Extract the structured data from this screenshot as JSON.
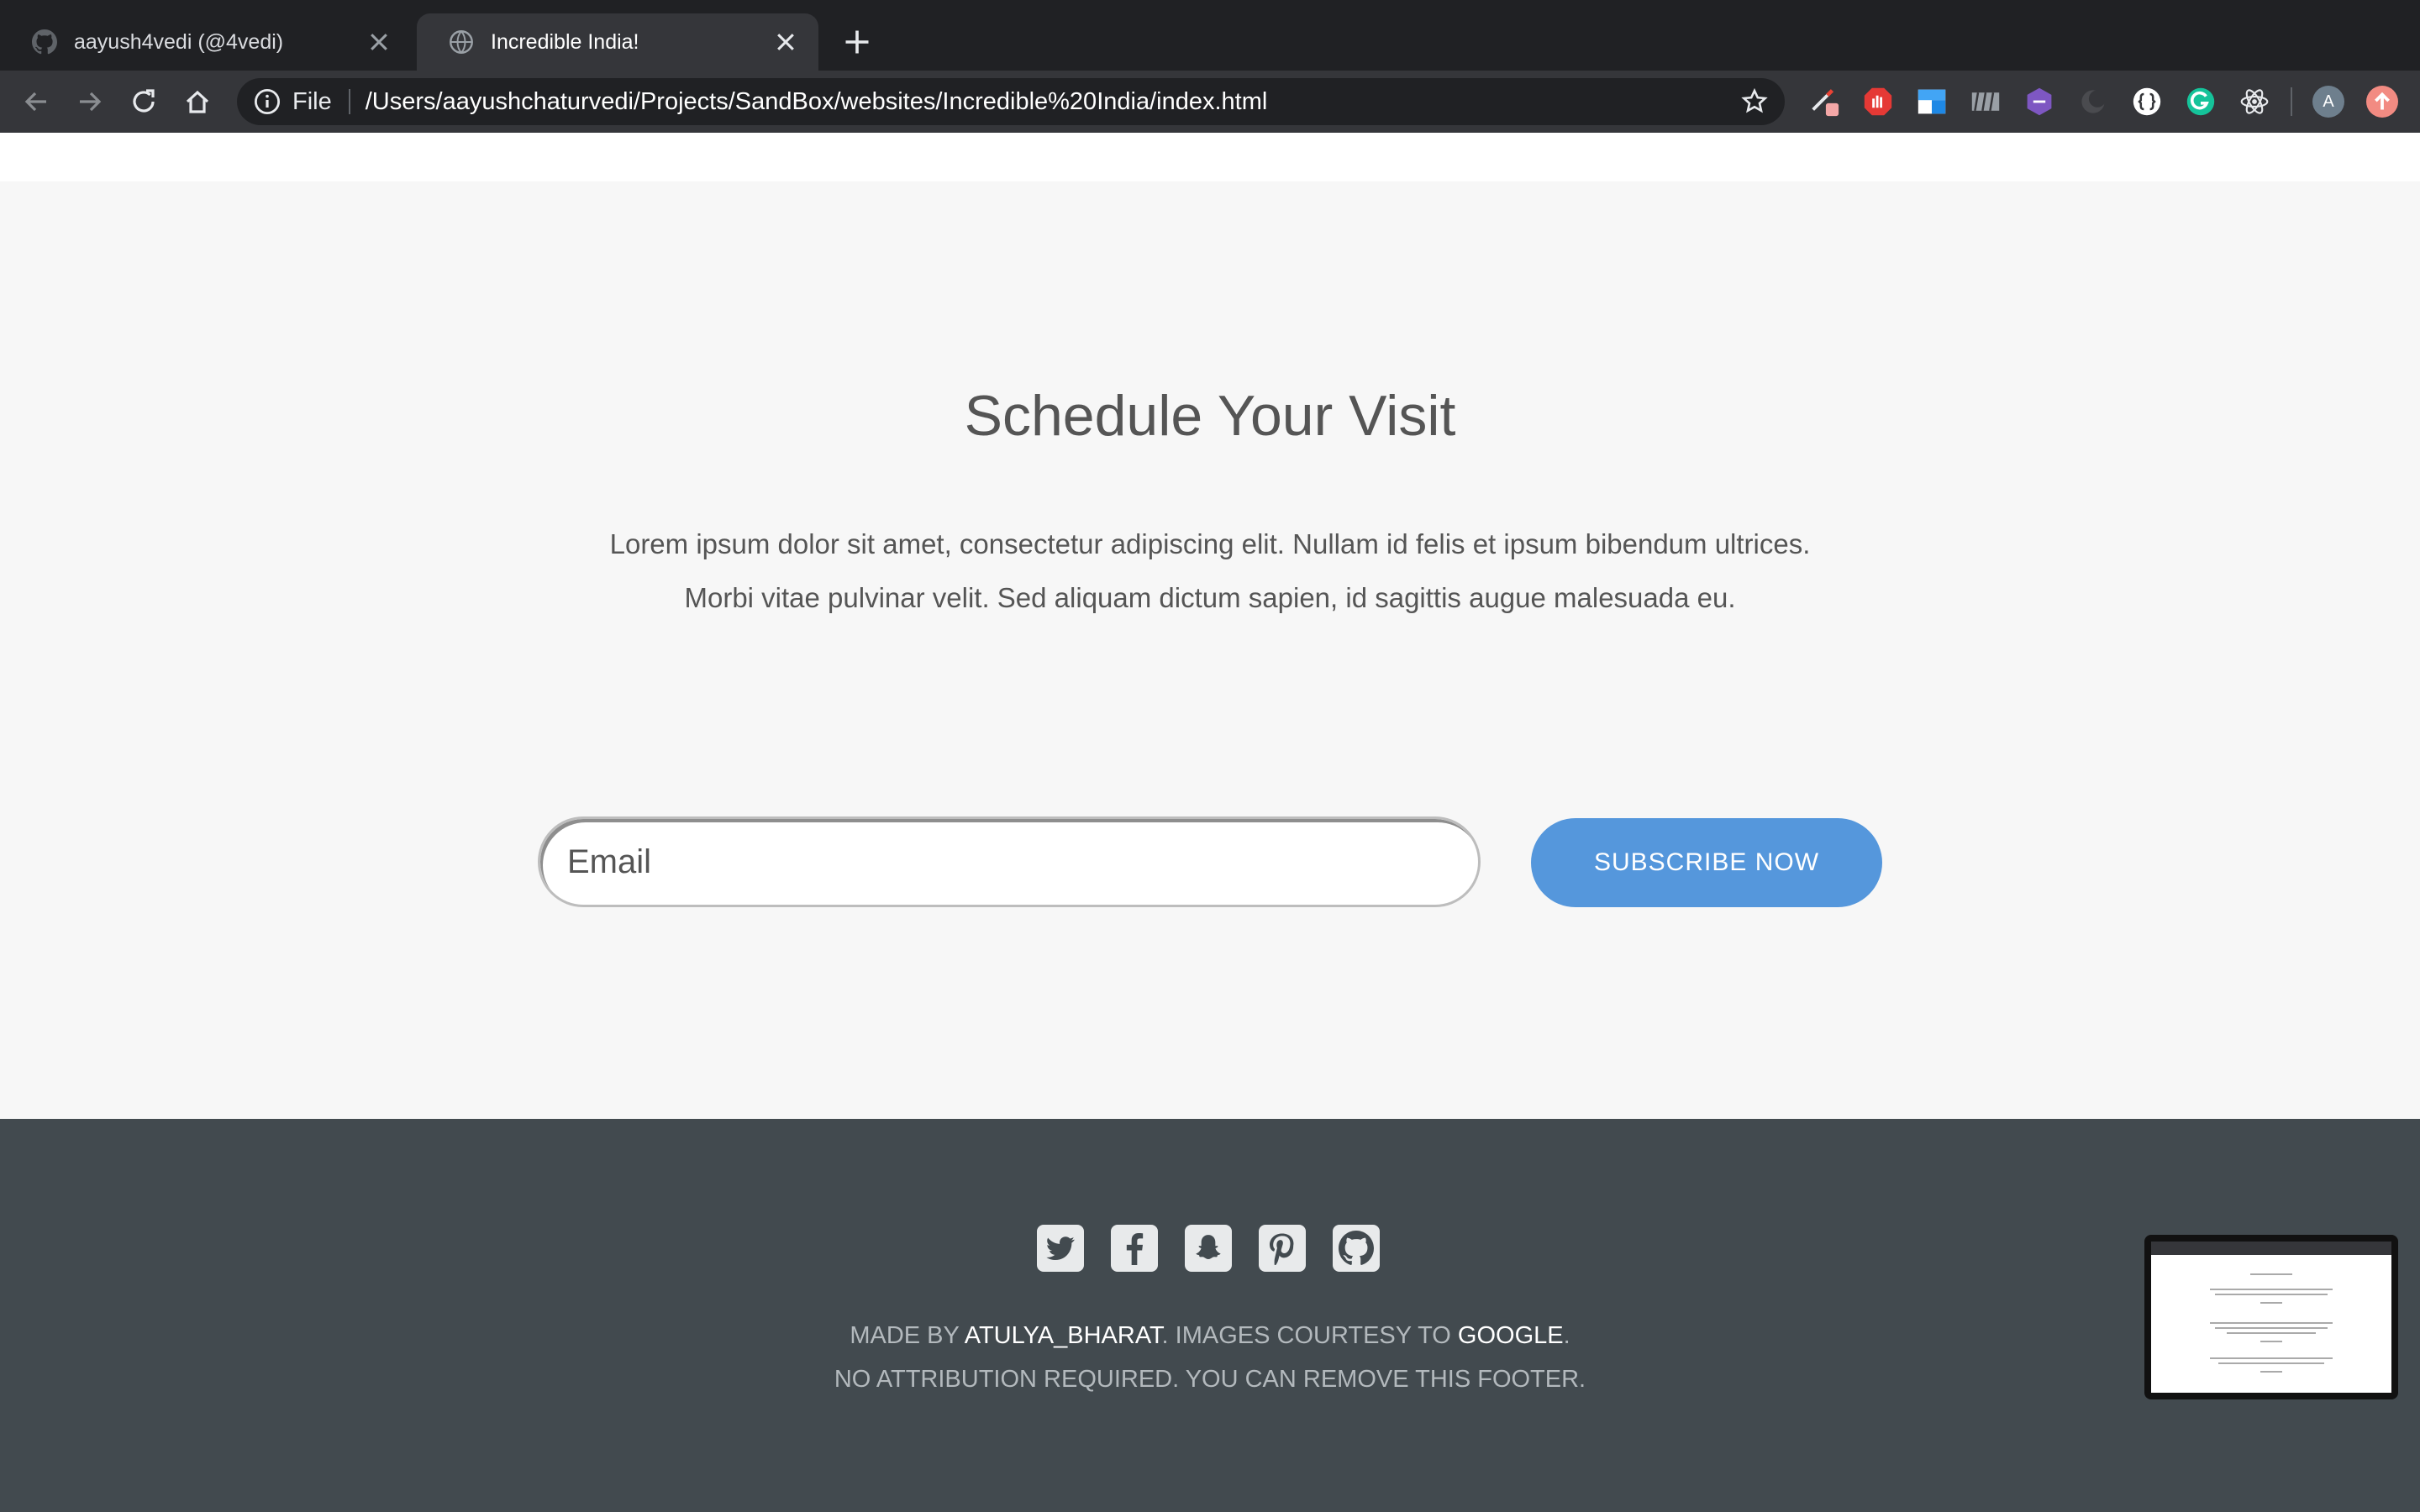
{
  "browser": {
    "tabs": [
      {
        "title": "aayush4vedi (@4vedi)",
        "icon": "github-icon",
        "active": false
      },
      {
        "title": "Incredible India!",
        "icon": "globe-icon",
        "active": true
      }
    ],
    "address": {
      "scheme": "File",
      "url": "/Users/aayushchaturvedi/Projects/SandBox/websites/Incredible%20India/index.html"
    },
    "profile_initial": "A",
    "colors": {
      "tabbar": "#202124",
      "toolbar": "#35363a"
    }
  },
  "schedule": {
    "title": "Schedule Your Visit",
    "lines": [
      "Lorem ipsum dolor sit amet, consectetur adipiscing elit. Nullam id felis et ipsum bibendum ultrices.",
      "Morbi vitae pulvinar velit. Sed aliquam dictum sapien, id sagittis augue malesuada eu."
    ],
    "email_placeholder": "Email",
    "subscribe_label": "SUBSCRIBE NOW",
    "accent": "#5597dc"
  },
  "footer": {
    "socials": [
      "twitter-icon",
      "facebook-icon",
      "snapchat-icon",
      "pinterest-icon",
      "github-icon"
    ],
    "made_by_prefix": "MADE BY ",
    "author": "ATULYA_BHARAT",
    "courtesy_text": ". IMAGES COURTESY TO ",
    "courtesy": "GOOGLE",
    "period": ".",
    "line2": "NO ATTRIBUTION REQUIRED. YOU CAN REMOVE THIS FOOTER.",
    "background": "#424a4f"
  }
}
